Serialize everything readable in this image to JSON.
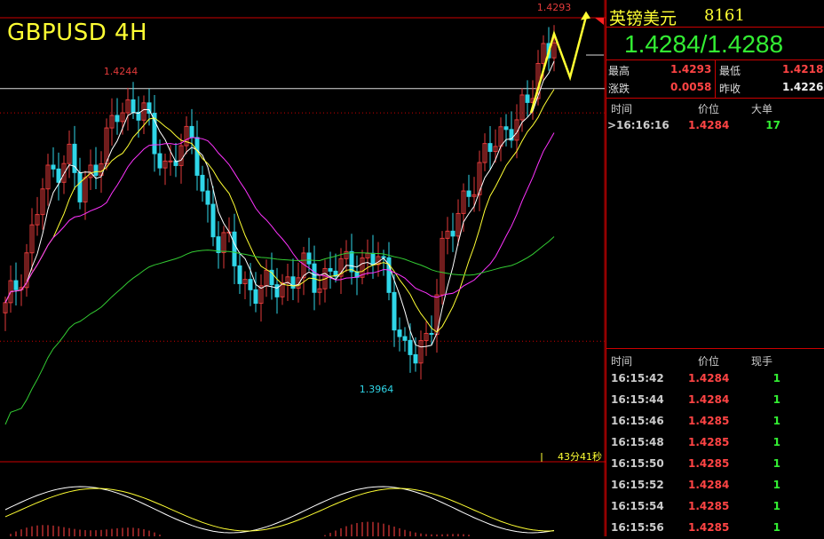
{
  "title": "GBPUSD 4H",
  "timer": "43分41秒",
  "colors": {
    "up": "#e23a3a",
    "down": "#2fd6e8",
    "ma5": "#ffffff",
    "ma10": "#ffff33",
    "ma20": "#ff33ff",
    "ma60": "#33cc33",
    "arrow": "#ffff33"
  },
  "panel": {
    "name": "英镑美元",
    "code": "8161",
    "quote": "1.4284/1.4288",
    "stats": {
      "high_label": "最高",
      "high": "1.4293",
      "low_label": "最低",
      "low": "1.4218",
      "change_label": "涨跌",
      "change": "0.0058",
      "prev_label": "昨收",
      "prev": "1.4226"
    },
    "big_header": {
      "time": "时间",
      "price": "价位",
      "qty": "大单"
    },
    "big_orders": [
      {
        "time": ">16:16:16",
        "price": "1.4284",
        "qty": "17"
      }
    ],
    "tick_header": {
      "time": "时间",
      "price": "价位",
      "qty": "现手"
    },
    "ticks": [
      {
        "time": "16:15:42",
        "price": "1.4284",
        "qty": "1"
      },
      {
        "time": "16:15:44",
        "price": "1.4284",
        "qty": "1"
      },
      {
        "time": "16:15:46",
        "price": "1.4285",
        "qty": "1"
      },
      {
        "time": "16:15:48",
        "price": "1.4285",
        "qty": "1"
      },
      {
        "time": "16:15:50",
        "price": "1.4285",
        "qty": "1"
      },
      {
        "time": "16:15:52",
        "price": "1.4284",
        "qty": "1"
      },
      {
        "time": "16:15:54",
        "price": "1.4285",
        "qty": "1"
      },
      {
        "time": "16:15:56",
        "price": "1.4285",
        "qty": "1"
      }
    ]
  },
  "chart_data": {
    "type": "candlestick",
    "symbol": "GBPUSD",
    "timeframe": "4H",
    "price_range": [
      1.388,
      1.43
    ],
    "annotations": [
      {
        "label": "1.4293",
        "price": 1.4293
      },
      {
        "label": "1.4244",
        "price": 1.4244
      },
      {
        "label": "1.3964",
        "price": 1.3964
      }
    ],
    "reference_lines": [
      {
        "price": 1.4239,
        "style": "solid"
      },
      {
        "price": 1.4215,
        "style": "dotted"
      },
      {
        "price": 1.399,
        "style": "dotted"
      }
    ],
    "close_path": [
      1.402,
      1.405,
      1.409,
      1.414,
      1.416,
      1.418,
      1.413,
      1.416,
      1.419,
      1.421,
      1.422,
      1.423,
      1.417,
      1.416,
      1.419,
      1.418,
      1.413,
      1.409,
      1.408,
      1.405,
      1.404,
      1.404,
      1.405,
      1.405,
      1.406,
      1.405,
      1.406,
      1.406,
      1.407,
      1.407,
      1.407,
      1.403,
      1.398,
      1.397,
      1.4,
      1.408,
      1.41,
      1.414,
      1.416,
      1.418,
      1.42,
      1.421,
      1.422,
      1.428,
      1.4284
    ],
    "forecast_arrow": [
      1.4215,
      1.4293,
      1.425,
      1.431
    ]
  }
}
